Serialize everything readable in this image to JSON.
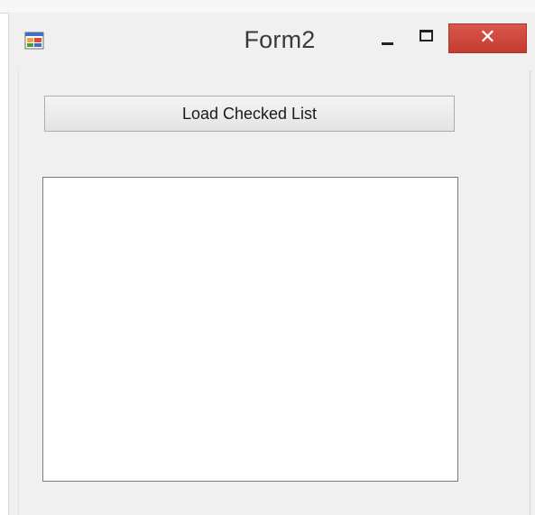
{
  "window": {
    "title": "Form2"
  },
  "titlebar": {
    "minimize": "minimize-icon",
    "maximize": "maximize-icon",
    "close_glyph": "✕"
  },
  "form": {
    "load_button_label": "Load Checked List",
    "checked_list_items": []
  },
  "colors": {
    "close_button": "#c8443a",
    "window_background": "#f0f0f0",
    "list_background": "#ffffff"
  }
}
